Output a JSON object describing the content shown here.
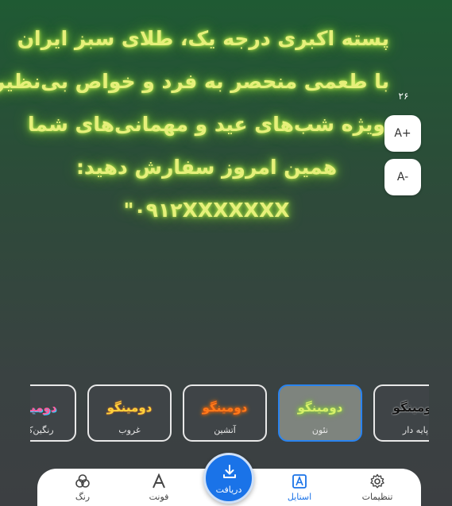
{
  "preview": {
    "lines": [
      "پسته اکبری درجه یک، طلای سبز ایران",
      "با طعمی منحصر به فرد و خواص بی‌نظیر",
      "ویژه شب‌های عید و مهمانی‌های شما",
      "همین امروز سفارش دهید:",
      "۰۹۱۲XXXXXXX\""
    ]
  },
  "font_size": {
    "value": "۲۶",
    "increase_label": "A+",
    "decrease_label": "A-"
  },
  "styles": [
    {
      "sample": "دومینگو",
      "name": "رنگین‌کمان"
    },
    {
      "sample": "دومینگو",
      "name": "غروب"
    },
    {
      "sample": "دومینگو",
      "name": "آتشین"
    },
    {
      "sample": "دومینگو",
      "name": "نئون",
      "selected": true
    },
    {
      "sample": "دومینگو",
      "name": "پایه دار"
    }
  ],
  "colors": {
    "accent": "#1a73e8",
    "neon_text": "#e6f07a",
    "neon_glow": "#8fd63a"
  },
  "nav": {
    "color": {
      "label": "رنگ",
      "icon": "palette-icon"
    },
    "font": {
      "label": "فونت",
      "icon": "font-icon"
    },
    "download": {
      "label": "دریافت",
      "icon": "download-icon"
    },
    "style": {
      "label": "استایل",
      "icon": "style-icon",
      "active": true
    },
    "settings": {
      "label": "تنظیمات",
      "icon": "gear-icon"
    }
  }
}
